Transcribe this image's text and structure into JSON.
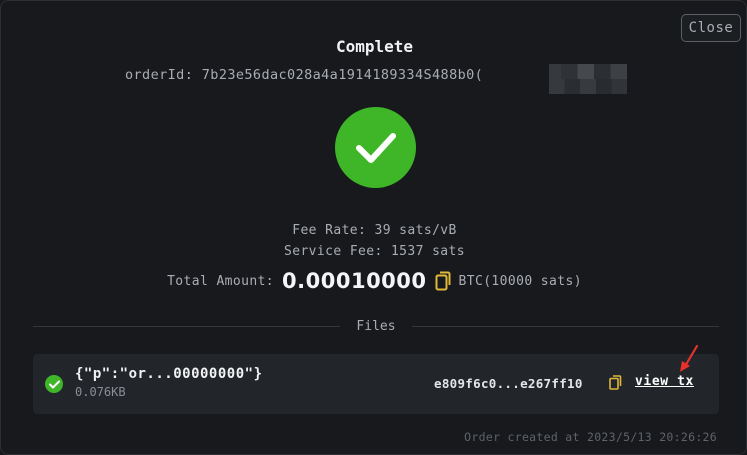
{
  "modal": {
    "close_label": "Close",
    "title": "Complete",
    "order_label": "orderId:",
    "order_id": "7b23e56dac028a4a1914189334S488b0("
  },
  "summary": {
    "fee_rate": "Fee Rate: 39 sats/vB",
    "service_fee": "Service Fee: 1537 sats",
    "total_label": "Total Amount:",
    "total_value": "0.00010000",
    "total_unit": "BTC(10000 sats)"
  },
  "files": {
    "section_label": "Files",
    "items": [
      {
        "name": "{\"p\":\"or...00000000\"}",
        "size": "0.076KB",
        "hash": "e809f6c0...e267ff10",
        "link_label": "view tx"
      }
    ]
  },
  "footer": {
    "created": "Order created at 2023/5/13 20:26:26"
  },
  "colors": {
    "success": "#3fb628",
    "copy_icon": "#e0b83a",
    "arrow": "#e8312a"
  }
}
